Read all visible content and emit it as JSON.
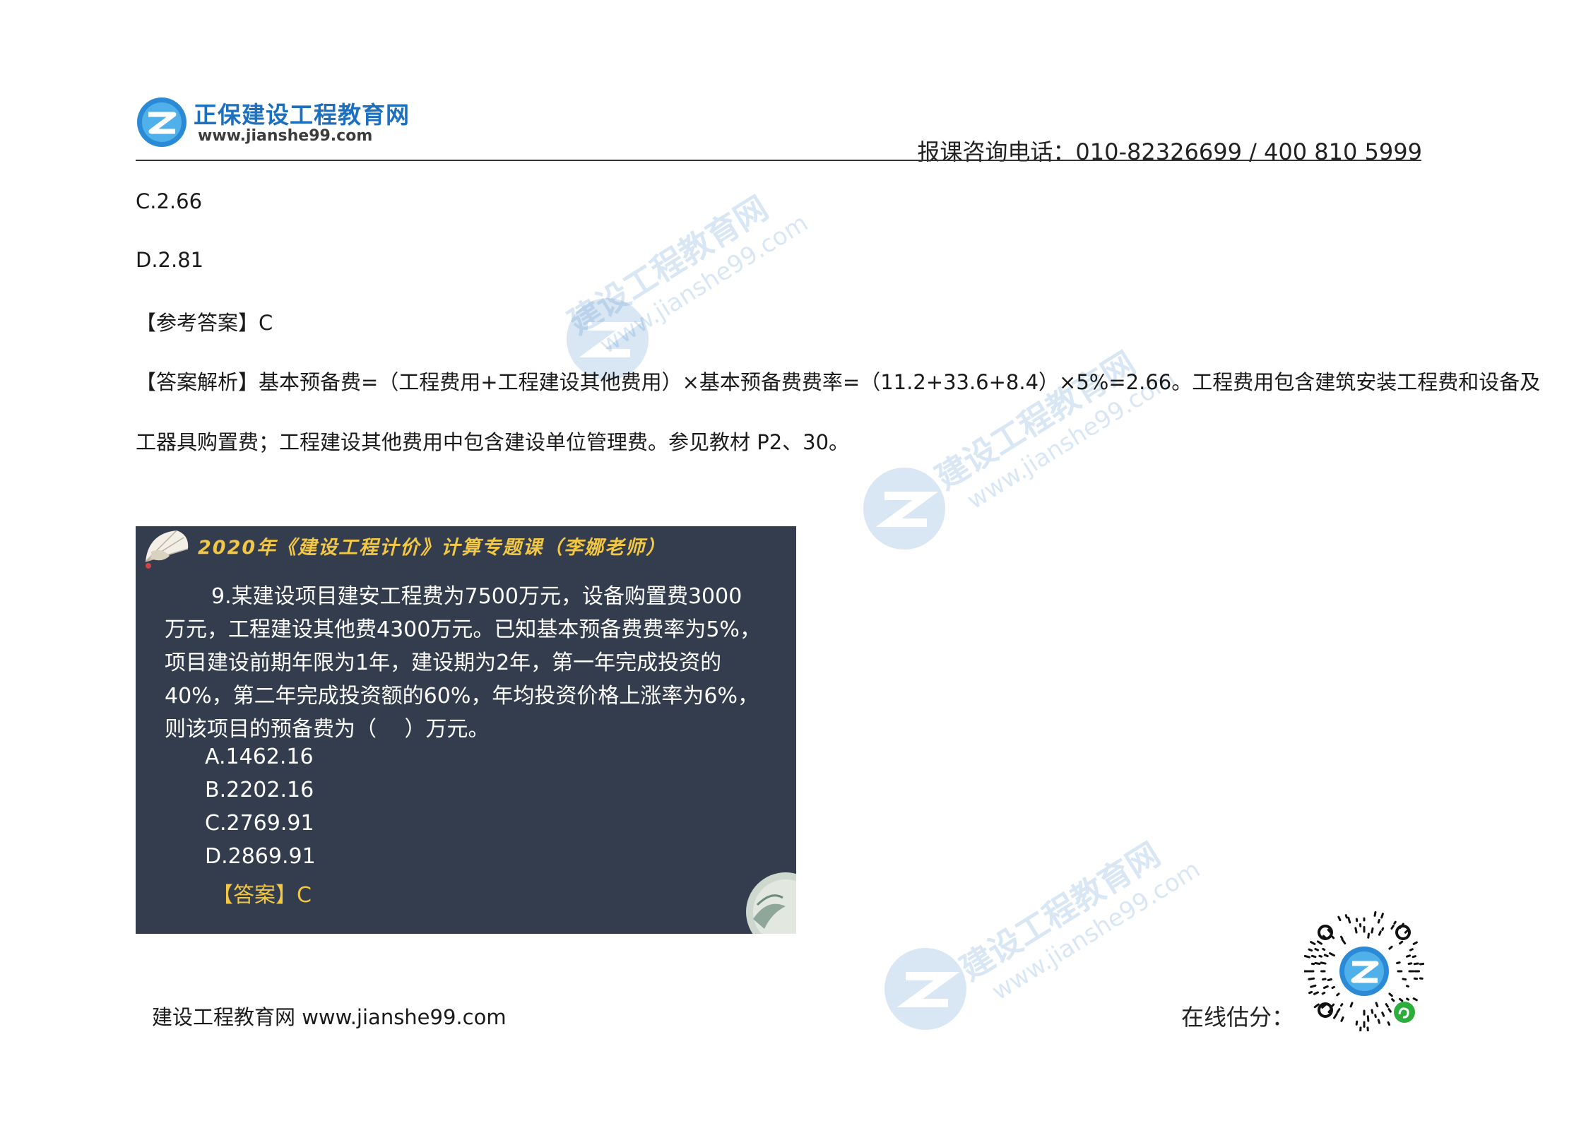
{
  "header": {
    "brand_name": "正保建设工程教育网",
    "brand_url": "www.jianshe99.com",
    "hotline": "报课咨询电话：010-82326699 / 400 810 5999"
  },
  "content": {
    "option_c": "C.2.66",
    "option_d": "D.2.81",
    "reference_answer": "【参考答案】C",
    "analysis_line1": "【答案解析】基本预备费=（工程费用+工程建设其他费用）×基本预备费费率=（11.2+33.6+8.4）×5%=2.66。工程费用包含建筑安装工程费和设备及",
    "analysis_line2": "工器具购置费；工程建设其他费用中包含建设单位管理费。参见教材 P2、30。"
  },
  "slide": {
    "title": "2020年《建设工程计价》计算专题课（李娜老师）",
    "question_lines": [
      "9.某建设项目建安工程费为7500万元，设备购置费3000",
      "万元，工程建设其他费4300万元。已知基本预备费费率为5%，",
      "项目建设前期年限为1年，建设期为2年，第一年完成投资的",
      "40%，第二年完成投资额的60%，年均投资价格上涨率为6%，",
      "则该项目的预备费为（　 ）万元。"
    ],
    "options": [
      "A.1462.16",
      "B.2202.16",
      "C.2769.91",
      "D.2869.91"
    ],
    "answer": "【答案】C"
  },
  "watermark": {
    "text_cn": "建设工程教育网",
    "text_url": "www.jianshe99.com"
  },
  "footer": {
    "site": "建设工程教育网  www.jianshe99.com",
    "score_label": "在线估分："
  },
  "colors": {
    "brand_blue": "#1d6fbf",
    "slide_bg": "#333d4d",
    "slide_accent": "#f2c744",
    "watermark": "#1d6fbf",
    "miniprogram_green": "#2bae3c"
  }
}
